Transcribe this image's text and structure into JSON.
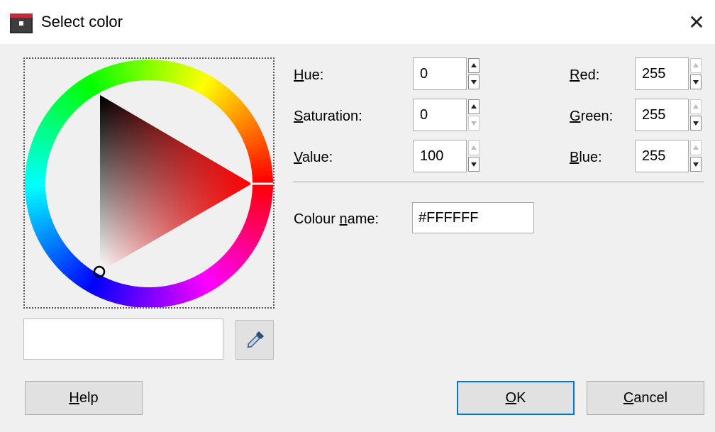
{
  "window": {
    "title": "Select color",
    "close_glyph": "✕",
    "app_icon": "gimp-window-icon"
  },
  "colors": {
    "accent": "#0078d7",
    "current_color": "#FFFFFF",
    "triangle_hue": "#FF0000"
  },
  "fields": {
    "hue": {
      "label_ul": "H",
      "label_rest": "ue:",
      "value": "0"
    },
    "saturation": {
      "label_ul": "S",
      "label_rest": "aturation:",
      "value": "0"
    },
    "value": {
      "label_ul": "V",
      "label_rest": "alue:",
      "value": "100"
    },
    "red": {
      "label_ul": "R",
      "label_rest": "ed:",
      "value": "255"
    },
    "green": {
      "label_ul": "G",
      "label_rest": "reen:",
      "value": "255"
    },
    "blue": {
      "label_ul": "B",
      "label_rest": "lue:",
      "value": "255"
    }
  },
  "colour_name": {
    "label_pre": "Colour ",
    "label_ul": "n",
    "label_post": "ame:",
    "value": "#FFFFFF"
  },
  "buttons": {
    "help": {
      "ul": "H",
      "rest": "elp"
    },
    "ok": {
      "ul": "O",
      "rest": "K"
    },
    "cancel": {
      "ul": "C",
      "rest": "ancel"
    }
  },
  "icons": {
    "eyedropper": "eyedropper-icon",
    "close": "close-icon"
  }
}
